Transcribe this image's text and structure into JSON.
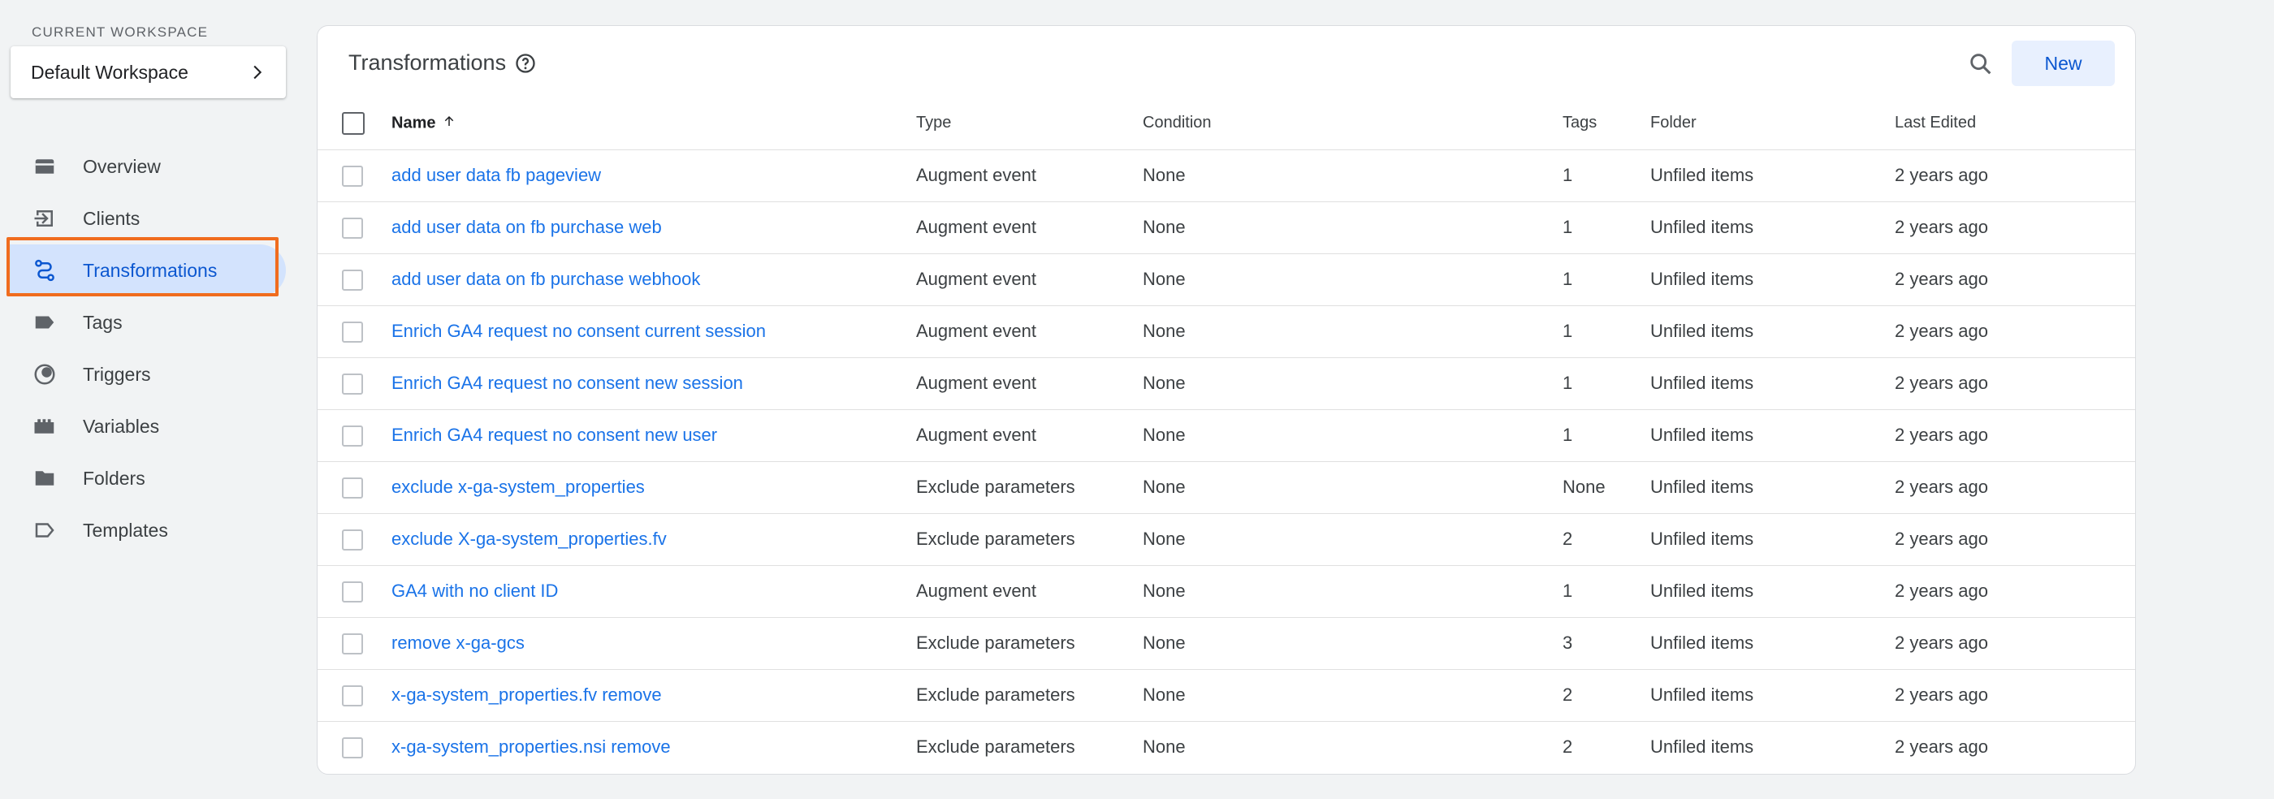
{
  "sidebar": {
    "workspace_label": "CURRENT WORKSPACE",
    "workspace_name": "Default Workspace",
    "nav": [
      {
        "label": "Overview",
        "icon": "overview-icon"
      },
      {
        "label": "Clients",
        "icon": "clients-icon"
      },
      {
        "label": "Transformations",
        "icon": "transformations-icon",
        "active": true
      },
      {
        "label": "Tags",
        "icon": "tag-icon"
      },
      {
        "label": "Triggers",
        "icon": "trigger-icon"
      },
      {
        "label": "Variables",
        "icon": "variables-icon"
      },
      {
        "label": "Folders",
        "icon": "folder-icon"
      },
      {
        "label": "Templates",
        "icon": "template-icon"
      }
    ]
  },
  "main": {
    "title": "Transformations",
    "new_label": "New",
    "columns": {
      "name": "Name",
      "type": "Type",
      "condition": "Condition",
      "tags": "Tags",
      "folder": "Folder",
      "last_edited": "Last Edited"
    },
    "rows": [
      {
        "name": "add user data fb pageview",
        "type": "Augment event",
        "condition": "None",
        "tags": "1",
        "folder": "Unfiled items",
        "edited": "2 years ago"
      },
      {
        "name": "add user data on fb purchase web",
        "type": "Augment event",
        "condition": "None",
        "tags": "1",
        "folder": "Unfiled items",
        "edited": "2 years ago"
      },
      {
        "name": "add user data on fb purchase webhook",
        "type": "Augment event",
        "condition": "None",
        "tags": "1",
        "folder": "Unfiled items",
        "edited": "2 years ago"
      },
      {
        "name": "Enrich GA4 request no consent current session",
        "type": "Augment event",
        "condition": "None",
        "tags": "1",
        "folder": "Unfiled items",
        "edited": "2 years ago"
      },
      {
        "name": "Enrich GA4 request no consent new session",
        "type": "Augment event",
        "condition": "None",
        "tags": "1",
        "folder": "Unfiled items",
        "edited": "2 years ago"
      },
      {
        "name": "Enrich GA4 request no consent new user",
        "type": "Augment event",
        "condition": "None",
        "tags": "1",
        "folder": "Unfiled items",
        "edited": "2 years ago"
      },
      {
        "name": "exclude x-ga-system_properties",
        "type": "Exclude parameters",
        "condition": "None",
        "tags": "None",
        "folder": "Unfiled items",
        "edited": "2 years ago"
      },
      {
        "name": "exclude X-ga-system_properties.fv",
        "type": "Exclude parameters",
        "condition": "None",
        "tags": "2",
        "folder": "Unfiled items",
        "edited": "2 years ago"
      },
      {
        "name": "GA4 with no client ID",
        "type": "Augment event",
        "condition": "None",
        "tags": "1",
        "folder": "Unfiled items",
        "edited": "2 years ago"
      },
      {
        "name": "remove x-ga-gcs",
        "type": "Exclude parameters",
        "condition": "None",
        "tags": "3",
        "folder": "Unfiled items",
        "edited": "2 years ago"
      },
      {
        "name": "x-ga-system_properties.fv remove",
        "type": "Exclude parameters",
        "condition": "None",
        "tags": "2",
        "folder": "Unfiled items",
        "edited": "2 years ago"
      },
      {
        "name": "x-ga-system_properties.nsi remove",
        "type": "Exclude parameters",
        "condition": "None",
        "tags": "2",
        "folder": "Unfiled items",
        "edited": "2 years ago"
      }
    ]
  },
  "colors": {
    "accent": "#0b57d0",
    "link": "#1a73e8",
    "active_bg": "#d3e3fd",
    "highlight": "#f06c1e"
  }
}
